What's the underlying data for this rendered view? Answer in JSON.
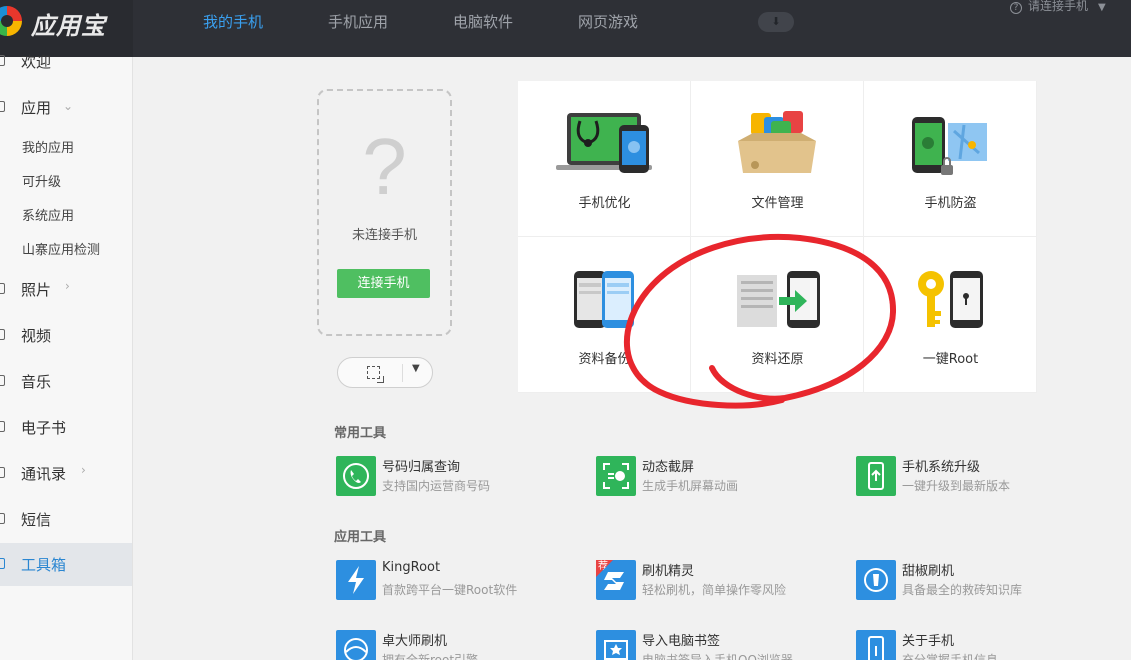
{
  "app": {
    "logo_text": "应用宝"
  },
  "nav": {
    "tabs": [
      {
        "label": "我的手机",
        "active": true
      },
      {
        "label": "手机应用"
      },
      {
        "label": "电脑软件"
      },
      {
        "label": "网页游戏"
      }
    ],
    "connect_hint": "请连接手机"
  },
  "sidebar": {
    "welcome": "欢迎",
    "apps": "应用",
    "apps_sub": [
      "我的应用",
      "可升级",
      "系统应用",
      "山寨应用检测"
    ],
    "photos": "照片",
    "video": "视频",
    "music": "音乐",
    "ebook": "电子书",
    "contacts": "通讯录",
    "sms": "短信",
    "toolbox": "工具箱"
  },
  "phone": {
    "placeholder_symbol": "?",
    "status": "未连接手机",
    "connect_label": "连接手机"
  },
  "grid": [
    {
      "label": "手机优化",
      "icon": "phone-optimize-icon"
    },
    {
      "label": "文件管理",
      "icon": "file-manage-icon"
    },
    {
      "label": "手机防盗",
      "icon": "anti-theft-icon"
    },
    {
      "label": "资料备份",
      "icon": "backup-icon"
    },
    {
      "label": "资料还原",
      "icon": "restore-icon"
    },
    {
      "label": "一键Root",
      "icon": "root-key-icon"
    }
  ],
  "common_tools": {
    "title": "常用工具",
    "items": [
      {
        "name": "号码归属查询",
        "desc": "支持国内运营商号码",
        "icon": "phone-lookup-icon",
        "color": "#2fb55a"
      },
      {
        "name": "动态截屏",
        "desc": "生成手机屏幕动画",
        "icon": "screen-capture-icon",
        "color": "#2fb55a"
      },
      {
        "name": "手机系统升级",
        "desc": "一键升级到最新版本",
        "icon": "system-upgrade-icon",
        "color": "#2fb55a"
      }
    ]
  },
  "app_tools": {
    "title": "应用工具",
    "items": [
      {
        "name": "KingRoot",
        "desc": "首款跨平台一键Root软件",
        "icon": "lightning-icon",
        "color": "#2d8fe0"
      },
      {
        "name": "刷机精灵",
        "desc": "轻松刷机，简单操作零风险",
        "icon": "flash-wizard-icon",
        "color": "#2d8fe0",
        "badge": "荐"
      },
      {
        "name": "甜椒刷机",
        "desc": "具备最全的救砖知识库",
        "icon": "sweet-pepper-icon",
        "color": "#2d8fe0"
      },
      {
        "name": "卓大师刷机",
        "desc": "拥有全新root引擎",
        "icon": "master-flash-icon",
        "color": "#2d8fe0"
      },
      {
        "name": "导入电脑书签",
        "desc": "电脑书签导入手机QQ浏览器",
        "icon": "bookmark-import-icon",
        "color": "#2d8fe0"
      },
      {
        "name": "关于手机",
        "desc": "充分掌握手机信息",
        "icon": "about-phone-icon",
        "color": "#2d8fe0"
      }
    ]
  }
}
